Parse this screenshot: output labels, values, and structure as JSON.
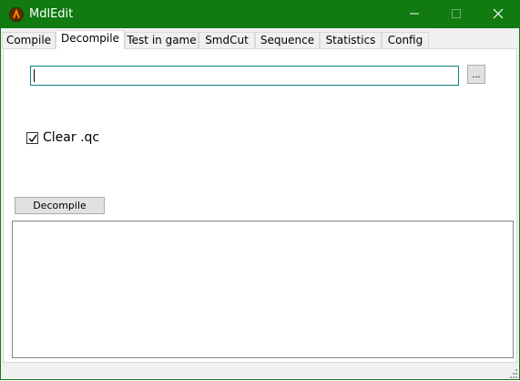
{
  "window": {
    "title": "MdlEdit",
    "icon": "half-life-lambda-icon",
    "title_bar_color": "#117a11",
    "controls": {
      "minimize": "minimize-icon",
      "maximize": "maximize-icon",
      "close": "close-icon"
    }
  },
  "tabs": [
    {
      "label": "Compile",
      "active": false
    },
    {
      "label": "Decompile",
      "active": true
    },
    {
      "label": "Test in game",
      "active": false
    },
    {
      "label": "SmdCut",
      "active": false
    },
    {
      "label": "Sequence",
      "active": false
    },
    {
      "label": "Statistics",
      "active": false
    },
    {
      "label": "Config",
      "active": false
    }
  ],
  "decompile": {
    "path_value": "",
    "browse_label": "...",
    "clear_qc": {
      "label": "Clear .qc",
      "checked": true
    },
    "button_label": "Decompile",
    "log_text": ""
  }
}
